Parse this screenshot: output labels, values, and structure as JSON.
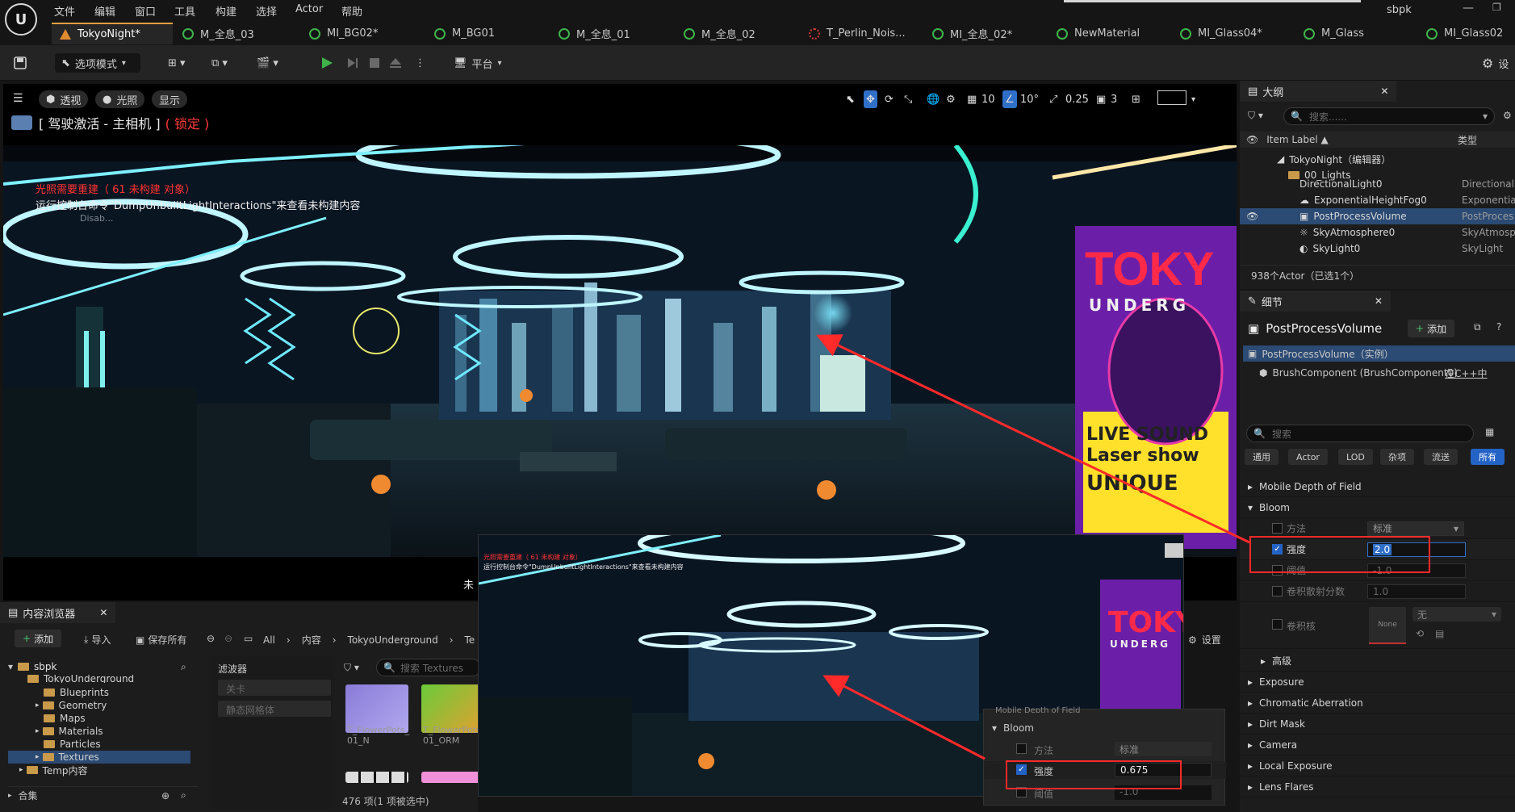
{
  "menu": {
    "items": [
      "文件",
      "编辑",
      "窗口",
      "工具",
      "构建",
      "选择",
      "Actor",
      "帮助"
    ],
    "project": "sbpk"
  },
  "tabs": [
    {
      "label": "TokyoNight*",
      "active": true,
      "icon": "level-icon"
    },
    {
      "label": "M_全息_03",
      "icon": "material-icon"
    },
    {
      "label": "MI_BG02*",
      "icon": "material-icon"
    },
    {
      "label": "M_BG01",
      "icon": "material-icon"
    },
    {
      "label": "M_全息_01",
      "icon": "material-icon"
    },
    {
      "label": "M_全息_02",
      "icon": "material-icon"
    },
    {
      "label": "T_Perlin_Nois...",
      "icon": "texture-icon"
    },
    {
      "label": "MI_全息_02*",
      "icon": "material-icon"
    },
    {
      "label": "NewMaterial",
      "icon": "material-icon"
    },
    {
      "label": "MI_Glass04*",
      "icon": "material-icon"
    },
    {
      "label": "M_Glass",
      "icon": "material-icon"
    },
    {
      "label": "MI_Glass02",
      "icon": "material-icon"
    }
  ],
  "toolbar": {
    "mode": "选项模式",
    "platform": "平台",
    "settings": "设"
  },
  "viewport": {
    "pills": [
      "透视",
      "光照",
      "显示"
    ],
    "title": "[ 驾驶激活 - 主相机 ]",
    "lock": "( 锁定 )",
    "grid_snap": "10",
    "rot_snap": "10°",
    "scale_snap": "0.25",
    "cam_speed": "3",
    "warning": "光照需要重建（ 61 未构建 对象）",
    "hint": "运行控制台命令\"DumpUnbuiltLightInteractions\"来查看未构建内容",
    "disabled": "Disab...",
    "overlap_fragment": "未"
  },
  "outliner": {
    "tab": "大纲",
    "search_placeholder": "搜索......",
    "col_label": "Item Label ▲",
    "col_type": "类型",
    "rows": [
      {
        "label": "TokyoNight（编辑器）",
        "type": "",
        "indent": 0
      },
      {
        "label": "00_Lights",
        "type": "",
        "indent": 1
      },
      {
        "label": "DirectionalLight0",
        "type": "DirectionalL",
        "indent": 2
      },
      {
        "label": "ExponentialHeightFog0",
        "type": "Exponential",
        "indent": 2
      },
      {
        "label": "PostProcessVolume",
        "type": "PostProces",
        "indent": 2,
        "selected": true
      },
      {
        "label": "SkyAtmosphere0",
        "type": "SkyAtmosp",
        "indent": 2
      },
      {
        "label": "SkyLight0",
        "type": "SkyLight",
        "indent": 2
      }
    ],
    "footer": "938个Actor（已选1个）"
  },
  "details": {
    "tab": "细节",
    "object_name": "PostProcessVolume",
    "add_label": "添加",
    "instance_label": "PostProcessVolume（实例）",
    "component_label": "BrushComponent (BrushComponent0)",
    "component_link": "在C++中",
    "search_placeholder": "搜索",
    "categories": [
      "通用",
      "Actor",
      "LOD",
      "杂项",
      "流送",
      "所有"
    ],
    "sections": {
      "mobile_dof": "Mobile Depth of Field",
      "bloom": "Bloom",
      "advanced": "高级",
      "exposure": "Exposure",
      "chromatic": "Chromatic Aberration",
      "dirt_mask": "Dirt Mask",
      "camera": "Camera",
      "local_exposure": "Local Exposure",
      "lens_flares": "Lens Flares"
    },
    "bloom_props": {
      "method_label": "方法",
      "method_value": "标准",
      "intensity_label": "强度",
      "intensity_value": "2.0",
      "threshold_label": "阈值",
      "threshold_value": "-1.0",
      "conv_label": "卷积散射分数",
      "conv_value": "1.0",
      "kernel_label": "卷积核",
      "kernel_value": "None",
      "kernel_dropdown": "无"
    }
  },
  "content_browser": {
    "tab": "内容浏览器",
    "add": "添加",
    "import": "导入",
    "save_all": "保存所有",
    "breadcrumb": [
      "All",
      "内容",
      "TokyoUnderground",
      "Te"
    ],
    "settings": "设置",
    "tree_root": "sbpk",
    "tree": [
      {
        "label": "TokyoUnderground",
        "indent": 1
      },
      {
        "label": "Blueprints",
        "indent": 2
      },
      {
        "label": "Geometry",
        "indent": 2
      },
      {
        "label": "Maps",
        "indent": 2
      },
      {
        "label": "Materials",
        "indent": 2
      },
      {
        "label": "Particles",
        "indent": 2
      },
      {
        "label": "Textures",
        "indent": 2,
        "selected": true
      },
      {
        "label": "Temp内容",
        "indent": 1
      }
    ],
    "collections": "合集",
    "filter_title": "滤波器",
    "filters": [
      "关卡",
      "静态网格体"
    ],
    "search_placeholder": "搜索 Textures",
    "assets": [
      {
        "label": "T_FlowerPots_\n01_N"
      },
      {
        "label": "T_FlowerPots\n01_ORM"
      }
    ],
    "status": "476 项(1 项被选中)"
  },
  "inset": {
    "warning": "光照需要重建（ 61 未构建 对象）",
    "hint": "运行控制台命令\"DumpUnbuiltLightInteractions\"来查看未构建内容",
    "section_partial": "Mobile Depth of Field",
    "bloom": "Bloom",
    "method_label": "方法",
    "method_value": "标准",
    "intensity_label": "强度",
    "intensity_value": "0.675",
    "threshold_label": "阈值",
    "threshold_value": "-1.0"
  },
  "neon_sign": {
    "line1": "TOKY",
    "line2": "UNDERG",
    "bottom1": "LIVE SOUND",
    "bottom2": "Laser show",
    "bottom3": "UNIQUE"
  },
  "colors": {
    "accent": "#2463c6",
    "annotation_red": "#ff2a2a",
    "lock_red": "#ff3b3b",
    "play_green": "#3fb34a"
  }
}
